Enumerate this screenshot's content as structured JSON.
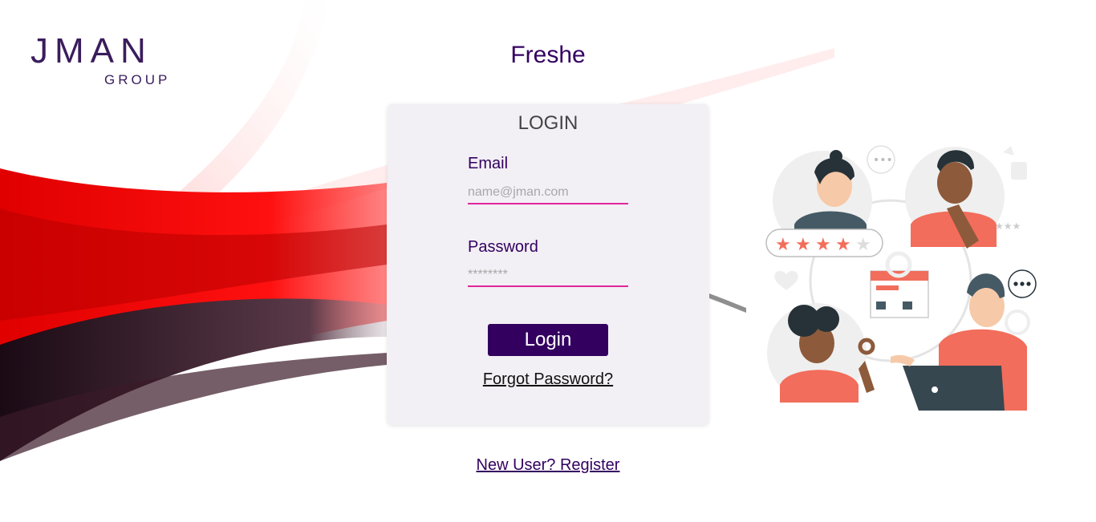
{
  "brand": {
    "logo_main": "JMAN",
    "logo_sub": "GROUP"
  },
  "app": {
    "title": "Freshe"
  },
  "login_card": {
    "title": "LOGIN",
    "email": {
      "label": "Email",
      "placeholder": "name@jman.com"
    },
    "password": {
      "label": "Password",
      "placeholder": "********"
    },
    "submit_label": "Login",
    "forgot_label": "Forgot Password?"
  },
  "register_label": "New User? Register",
  "colors": {
    "primary": "#330060",
    "accent": "#e0259a",
    "card_bg": "#f2eff5",
    "illustration_coral": "#f26d5b"
  },
  "icons": [
    "jman-logo",
    "people-review-illustration",
    "star-icon",
    "chat-bubble-icon",
    "laptop-icon"
  ]
}
